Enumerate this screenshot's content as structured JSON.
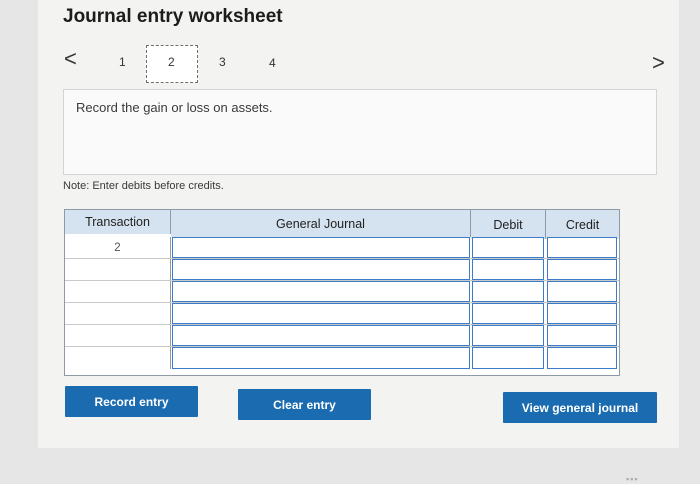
{
  "title": "Journal entry worksheet",
  "nav": {
    "prev_label": "<",
    "next_label": ">",
    "steps": [
      "1",
      "2",
      "3",
      "4"
    ],
    "active_step": "2"
  },
  "prompt": "Record the gain or loss on assets.",
  "note": "Note: Enter debits before credits.",
  "table": {
    "headers": {
      "transaction": "Transaction",
      "journal": "General Journal",
      "debit": "Debit",
      "credit": "Credit"
    },
    "rows": [
      {
        "transaction": "2",
        "journal": "",
        "debit": "",
        "credit": ""
      },
      {
        "transaction": "",
        "journal": "",
        "debit": "",
        "credit": ""
      },
      {
        "transaction": "",
        "journal": "",
        "debit": "",
        "credit": ""
      },
      {
        "transaction": "",
        "journal": "",
        "debit": "",
        "credit": ""
      },
      {
        "transaction": "",
        "journal": "",
        "debit": "",
        "credit": ""
      },
      {
        "transaction": "",
        "journal": "",
        "debit": "",
        "credit": ""
      }
    ]
  },
  "buttons": {
    "record": "Record entry",
    "clear": "Clear entry",
    "view": "View general journal"
  },
  "colors": {
    "header_bg": "#d5e2ef",
    "button_bg": "#1a6bb0",
    "input_border": "#3d7cc9"
  }
}
